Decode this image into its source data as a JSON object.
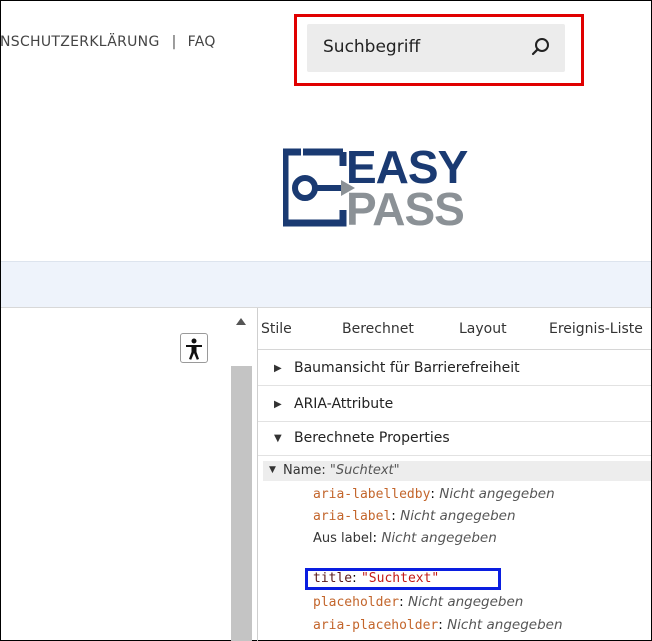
{
  "topnav": {
    "privacy_label": "NSCHUTZERKLÄRUNG",
    "separator": "|",
    "faq_label": "FAQ"
  },
  "search": {
    "placeholder": "Suchbegriff",
    "icon": "search-icon"
  },
  "logo": {
    "line1": "EASY",
    "line2": "PASS",
    "colors": {
      "primary": "#1a3a72",
      "secondary": "#8b9196"
    }
  },
  "devtools": {
    "tabs": [
      "Stile",
      "Berechnet",
      "Layout",
      "Ereignis-Liste"
    ],
    "sections": [
      {
        "label": "Baumansicht für Barrierefreiheit",
        "expanded": false
      },
      {
        "label": "ARIA-Attribute",
        "expanded": false
      },
      {
        "label": "Berechnete Properties",
        "expanded": true
      }
    ],
    "name_row": {
      "label": "Name: ",
      "value": "\"Suchtext\""
    },
    "properties": [
      {
        "key": "aria-labelledby",
        "sep": ": ",
        "value": "Nicht angegeben",
        "style": "orange"
      },
      {
        "key": "aria-label",
        "sep": ": ",
        "value": "Nicht angegeben",
        "style": "orange"
      },
      {
        "key": "Aus label",
        "sep": ": ",
        "value": "Nicht angegeben",
        "style": "plain"
      },
      {
        "key": "title",
        "sep": ": ",
        "value": "\"Suchtext\"",
        "style": "dark"
      },
      {
        "key": "placeholder",
        "sep": ": ",
        "value": "Nicht angegeben",
        "style": "orange"
      },
      {
        "key": "aria-placeholder",
        "sep": ": ",
        "value": "Nicht angegeben",
        "style": "orange"
      }
    ]
  },
  "colors": {
    "highlight_red": "#e00000",
    "highlight_blue": "#0a1ee0"
  }
}
